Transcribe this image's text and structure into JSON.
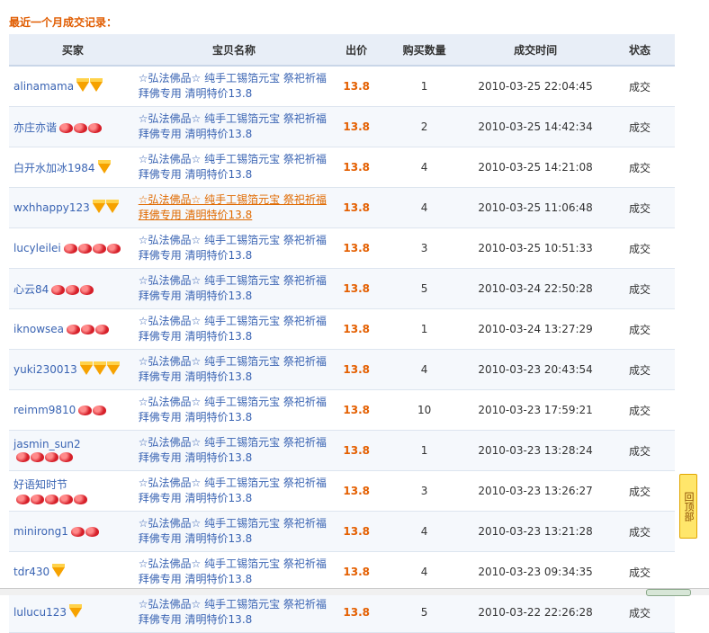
{
  "section_title": "最近一个月成交记录：",
  "columns": [
    "买家",
    "宝贝名称",
    "出价",
    "购买数量",
    "成交时间",
    "状态"
  ],
  "rows": [
    {
      "buyer": "alinamama",
      "badge": "diamond",
      "badge_count": 2,
      "item_line1": "☆弘法佛品☆ 纯手工锡箔元宝 祭祀祈福",
      "item_line2": "拜佛专用 清明特价13.8",
      "price": "13.8",
      "qty": "1",
      "time": "2010-03-25 22:04:45",
      "status": "成交"
    },
    {
      "buyer": "亦庄亦谐",
      "badge": "heart",
      "badge_count": 3,
      "item_line1": "☆弘法佛品☆ 纯手工锡箔元宝 祭祀祈福",
      "item_line2": "拜佛专用 清明特价13.8",
      "price": "13.8",
      "qty": "2",
      "time": "2010-03-25 14:42:34",
      "status": "成交"
    },
    {
      "buyer": "白开水加冰1984",
      "badge": "diamond",
      "badge_count": 1,
      "item_line1": "☆弘法佛品☆ 纯手工锡箔元宝 祭祀祈福",
      "item_line2": "拜佛专用 清明特价13.8",
      "price": "13.8",
      "qty": "4",
      "time": "2010-03-25 14:21:08",
      "status": "成交"
    },
    {
      "buyer": "wxhhappy123",
      "badge": "diamond",
      "badge_count": 2,
      "item_line1": "☆弘法佛品☆ 纯手工锡箔元宝 祭祀祈福",
      "item_line2": "拜佛专用 清明特价13.8",
      "price": "13.8",
      "qty": "4",
      "time": "2010-03-25 11:06:48",
      "status": "成交",
      "hover": true
    },
    {
      "buyer": "lucyleilei",
      "badge": "heart",
      "badge_count": 4,
      "item_line1": "☆弘法佛品☆ 纯手工锡箔元宝 祭祀祈福",
      "item_line2": "拜佛专用 清明特价13.8",
      "price": "13.8",
      "qty": "3",
      "time": "2010-03-25 10:51:33",
      "status": "成交"
    },
    {
      "buyer": "心云84",
      "badge": "heart",
      "badge_count": 3,
      "item_line1": "☆弘法佛品☆ 纯手工锡箔元宝 祭祀祈福",
      "item_line2": "拜佛专用 清明特价13.8",
      "price": "13.8",
      "qty": "5",
      "time": "2010-03-24 22:50:28",
      "status": "成交"
    },
    {
      "buyer": "iknowsea",
      "badge": "heart",
      "badge_count": 3,
      "item_line1": "☆弘法佛品☆ 纯手工锡箔元宝 祭祀祈福",
      "item_line2": "拜佛专用 清明特价13.8",
      "price": "13.8",
      "qty": "1",
      "time": "2010-03-24 13:27:29",
      "status": "成交"
    },
    {
      "buyer": "yuki230013",
      "badge": "diamond",
      "badge_count": 3,
      "item_line1": "☆弘法佛品☆ 纯手工锡箔元宝 祭祀祈福",
      "item_line2": "拜佛专用 清明特价13.8",
      "price": "13.8",
      "qty": "4",
      "time": "2010-03-23 20:43:54",
      "status": "成交"
    },
    {
      "buyer": "reimm9810",
      "badge": "heart",
      "badge_count": 2,
      "item_line1": "☆弘法佛品☆ 纯手工锡箔元宝 祭祀祈福",
      "item_line2": "拜佛专用 清明特价13.8",
      "price": "13.8",
      "qty": "10",
      "time": "2010-03-23 17:59:21",
      "status": "成交"
    },
    {
      "buyer": "jasmin_sun2",
      "badge": "heart",
      "badge_count": 4,
      "item_line1": "☆弘法佛品☆ 纯手工锡箔元宝 祭祀祈福",
      "item_line2": "拜佛专用 清明特价13.8",
      "price": "13.8",
      "qty": "1",
      "time": "2010-03-23 13:28:24",
      "status": "成交",
      "badges_below": true
    },
    {
      "buyer": "好语知时节",
      "badge": "heart",
      "badge_count": 5,
      "item_line1": "☆弘法佛品☆ 纯手工锡箔元宝 祭祀祈福",
      "item_line2": "拜佛专用 清明特价13.8",
      "price": "13.8",
      "qty": "3",
      "time": "2010-03-23 13:26:27",
      "status": "成交",
      "badges_below": true
    },
    {
      "buyer": "minirong1",
      "badge": "heart",
      "badge_count": 2,
      "item_line1": "☆弘法佛品☆ 纯手工锡箔元宝 祭祀祈福",
      "item_line2": "拜佛专用 清明特价13.8",
      "price": "13.8",
      "qty": "4",
      "time": "2010-03-23 13:21:28",
      "status": "成交"
    },
    {
      "buyer": "tdr430",
      "badge": "diamond",
      "badge_count": 1,
      "item_line1": "☆弘法佛品☆ 纯手工锡箔元宝 祭祀祈福",
      "item_line2": "拜佛专用 清明特价13.8",
      "price": "13.8",
      "qty": "4",
      "time": "2010-03-23 09:34:35",
      "status": "成交"
    },
    {
      "buyer": "lulucu123",
      "badge": "diamond",
      "badge_count": 1,
      "item_line1": "☆弘法佛品☆ 纯手工锡箔元宝 祭祀祈福",
      "item_line2": "拜佛专用 清明特价13.8",
      "price": "13.8",
      "qty": "5",
      "time": "2010-03-22 22:26:28",
      "status": "成交"
    }
  ],
  "back_to_top": "回顶部",
  "colors": {
    "title": "#e05c00",
    "price": "#e45f00",
    "link": "#3a64b3",
    "header_bg": "#e8eef7"
  }
}
